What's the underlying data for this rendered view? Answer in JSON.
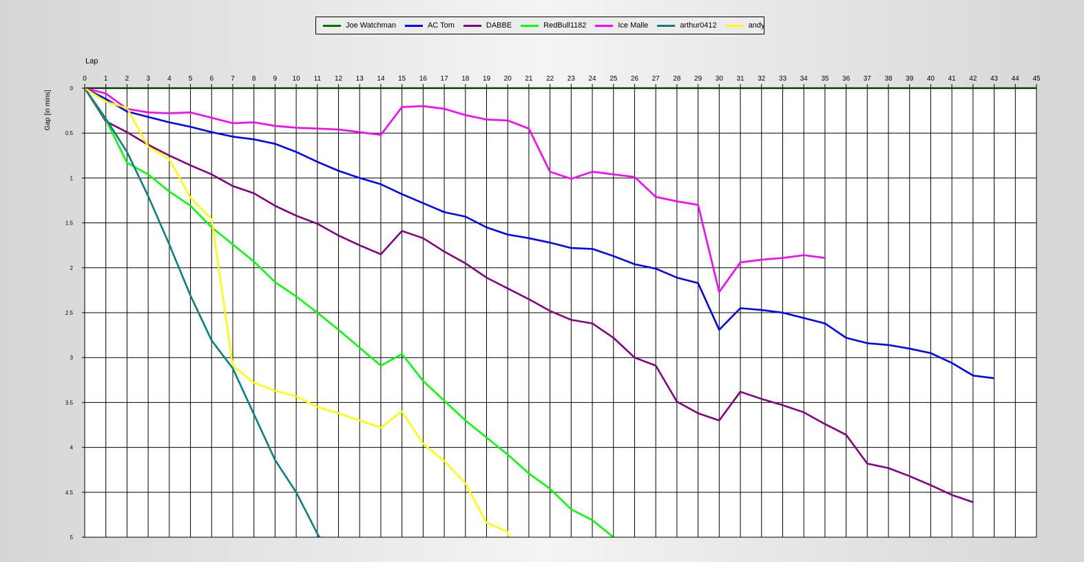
{
  "chart_data": {
    "type": "line",
    "xlabel": "Lap",
    "ylabel": "Gap [in mins]",
    "xlim": [
      0,
      45
    ],
    "ylim": [
      0,
      5
    ],
    "y_inverted": true,
    "grid": true,
    "legend_position": "top-center",
    "x_ticks": [
      0,
      1,
      2,
      3,
      4,
      5,
      6,
      7,
      8,
      9,
      10,
      11,
      12,
      13,
      14,
      15,
      16,
      17,
      18,
      19,
      20,
      21,
      22,
      23,
      24,
      25,
      26,
      27,
      28,
      29,
      30,
      31,
      32,
      33,
      34,
      35,
      36,
      37,
      38,
      39,
      40,
      41,
      42,
      43,
      44,
      45
    ],
    "y_ticks": [
      "0",
      "0.5",
      "1",
      "1.5",
      "2",
      "2.5",
      "3",
      "3.5",
      "4",
      "4.5",
      "5"
    ],
    "series": [
      {
        "name": "Joe Watchman",
        "color": "#007000",
        "points": [
          [
            0,
            0
          ],
          [
            1,
            0
          ],
          [
            2,
            0
          ],
          [
            3,
            0
          ],
          [
            4,
            0
          ],
          [
            5,
            0
          ],
          [
            6,
            0
          ],
          [
            7,
            0
          ],
          [
            8,
            0
          ],
          [
            9,
            0
          ],
          [
            10,
            0
          ],
          [
            11,
            0
          ],
          [
            12,
            0
          ],
          [
            13,
            0
          ],
          [
            14,
            0
          ],
          [
            15,
            0
          ],
          [
            16,
            0
          ],
          [
            17,
            0
          ],
          [
            18,
            0
          ],
          [
            19,
            0
          ],
          [
            20,
            0
          ],
          [
            21,
            0
          ],
          [
            22,
            0
          ],
          [
            23,
            0
          ],
          [
            24,
            0
          ],
          [
            25,
            0
          ],
          [
            26,
            0
          ],
          [
            27,
            0
          ],
          [
            28,
            0
          ],
          [
            29,
            0
          ],
          [
            30,
            0
          ],
          [
            31,
            0
          ],
          [
            32,
            0
          ],
          [
            33,
            0
          ],
          [
            34,
            0
          ],
          [
            35,
            0
          ],
          [
            36,
            0
          ],
          [
            37,
            0
          ],
          [
            38,
            0
          ],
          [
            39,
            0
          ],
          [
            40,
            0
          ],
          [
            41,
            0
          ],
          [
            42,
            0
          ],
          [
            43,
            0
          ],
          [
            44,
            0
          ],
          [
            45,
            0
          ]
        ]
      },
      {
        "name": "AC Tom",
        "color": "#0000ff",
        "points": [
          [
            0,
            0
          ],
          [
            1,
            0.12
          ],
          [
            2,
            0.26
          ],
          [
            3,
            0.32
          ],
          [
            4,
            0.38
          ],
          [
            5,
            0.43
          ],
          [
            6,
            0.49
          ],
          [
            7,
            0.54
          ],
          [
            8,
            0.57
          ],
          [
            9,
            0.62
          ],
          [
            10,
            0.71
          ],
          [
            11,
            0.82
          ],
          [
            12,
            0.92
          ],
          [
            13,
            1.0
          ],
          [
            14,
            1.07
          ],
          [
            15,
            1.18
          ],
          [
            16,
            1.28
          ],
          [
            17,
            1.38
          ],
          [
            18,
            1.43
          ],
          [
            19,
            1.55
          ],
          [
            20,
            1.63
          ],
          [
            21,
            1.67
          ],
          [
            22,
            1.72
          ],
          [
            23,
            1.78
          ],
          [
            24,
            1.79
          ],
          [
            25,
            1.87
          ],
          [
            26,
            1.96
          ],
          [
            27,
            2.01
          ],
          [
            28,
            2.11
          ],
          [
            29,
            2.17
          ],
          [
            30,
            2.69
          ],
          [
            31,
            2.45
          ],
          [
            32,
            2.47
          ],
          [
            33,
            2.5
          ],
          [
            34,
            2.56
          ],
          [
            35,
            2.62
          ],
          [
            36,
            2.78
          ],
          [
            37,
            2.84
          ],
          [
            38,
            2.86
          ],
          [
            39,
            2.9
          ],
          [
            40,
            2.95
          ],
          [
            41,
            3.06
          ],
          [
            42,
            3.2
          ],
          [
            43,
            3.23
          ]
        ]
      },
      {
        "name": "DABBE",
        "color": "#800080",
        "points": [
          [
            0,
            0
          ],
          [
            1,
            0.37
          ],
          [
            2,
            0.49
          ],
          [
            3,
            0.63
          ],
          [
            4,
            0.75
          ],
          [
            5,
            0.86
          ],
          [
            6,
            0.96
          ],
          [
            7,
            1.09
          ],
          [
            8,
            1.17
          ],
          [
            9,
            1.31
          ],
          [
            10,
            1.42
          ],
          [
            11,
            1.51
          ],
          [
            12,
            1.64
          ],
          [
            13,
            1.75
          ],
          [
            14,
            1.85
          ],
          [
            15,
            1.59
          ],
          [
            16,
            1.67
          ],
          [
            17,
            1.82
          ],
          [
            18,
            1.95
          ],
          [
            19,
            2.11
          ],
          [
            20,
            2.23
          ],
          [
            21,
            2.35
          ],
          [
            22,
            2.48
          ],
          [
            23,
            2.58
          ],
          [
            24,
            2.62
          ],
          [
            25,
            2.78
          ],
          [
            26,
            3.0
          ],
          [
            27,
            3.09
          ],
          [
            28,
            3.49
          ],
          [
            29,
            3.62
          ],
          [
            30,
            3.7
          ],
          [
            31,
            3.38
          ],
          [
            32,
            3.46
          ],
          [
            33,
            3.53
          ],
          [
            34,
            3.61
          ],
          [
            35,
            3.74
          ],
          [
            36,
            3.86
          ],
          [
            37,
            4.18
          ],
          [
            38,
            4.23
          ],
          [
            39,
            4.32
          ],
          [
            40,
            4.42
          ],
          [
            41,
            4.53
          ],
          [
            42,
            4.61
          ]
        ]
      },
      {
        "name": "RedBull1182",
        "color": "#00ff00",
        "points": [
          [
            0,
            0
          ],
          [
            1,
            0.35
          ],
          [
            2,
            0.83
          ],
          [
            3,
            0.96
          ],
          [
            4,
            1.15
          ],
          [
            5,
            1.31
          ],
          [
            6,
            1.55
          ],
          [
            7,
            1.74
          ],
          [
            8,
            1.93
          ],
          [
            9,
            2.16
          ],
          [
            10,
            2.32
          ],
          [
            11,
            2.5
          ],
          [
            12,
            2.69
          ],
          [
            13,
            2.89
          ],
          [
            14,
            3.09
          ],
          [
            15,
            2.96
          ],
          [
            16,
            3.26
          ],
          [
            17,
            3.48
          ],
          [
            18,
            3.7
          ],
          [
            19,
            3.89
          ],
          [
            20,
            4.08
          ],
          [
            21,
            4.29
          ],
          [
            22,
            4.46
          ],
          [
            23,
            4.69
          ],
          [
            24,
            4.81
          ],
          [
            25,
            5.0
          ]
        ]
      },
      {
        "name": "Ice Malle",
        "color": "#ff00ff",
        "points": [
          [
            0,
            0
          ],
          [
            1,
            0.06
          ],
          [
            2,
            0.23
          ],
          [
            3,
            0.27
          ],
          [
            4,
            0.28
          ],
          [
            5,
            0.27
          ],
          [
            6,
            0.33
          ],
          [
            7,
            0.39
          ],
          [
            8,
            0.38
          ],
          [
            9,
            0.42
          ],
          [
            10,
            0.44
          ],
          [
            11,
            0.45
          ],
          [
            12,
            0.46
          ],
          [
            13,
            0.49
          ],
          [
            14,
            0.52
          ],
          [
            15,
            0.21
          ],
          [
            16,
            0.2
          ],
          [
            17,
            0.23
          ],
          [
            18,
            0.3
          ],
          [
            19,
            0.35
          ],
          [
            20,
            0.36
          ],
          [
            21,
            0.45
          ],
          [
            22,
            0.93
          ],
          [
            23,
            1.01
          ],
          [
            24,
            0.93
          ],
          [
            25,
            0.96
          ],
          [
            26,
            0.99
          ],
          [
            27,
            1.21
          ],
          [
            28,
            1.26
          ],
          [
            29,
            1.3
          ],
          [
            30,
            2.27
          ],
          [
            31,
            1.94
          ],
          [
            32,
            1.91
          ],
          [
            33,
            1.89
          ],
          [
            34,
            1.86
          ],
          [
            35,
            1.89
          ]
        ]
      },
      {
        "name": "arthur0412",
        "color": "#008080",
        "points": [
          [
            0,
            0
          ],
          [
            1,
            0.34
          ],
          [
            2,
            0.71
          ],
          [
            3,
            1.2
          ],
          [
            4,
            1.74
          ],
          [
            5,
            2.31
          ],
          [
            6,
            2.81
          ],
          [
            7,
            3.12
          ],
          [
            8,
            3.63
          ],
          [
            9,
            4.14
          ],
          [
            10,
            4.5
          ],
          [
            11,
            4.96
          ],
          [
            11.1,
            5.0
          ]
        ]
      },
      {
        "name": "andymaz",
        "color": "#ffff00",
        "points": [
          [
            0,
            0
          ],
          [
            1,
            0.15
          ],
          [
            2,
            0.22
          ],
          [
            3,
            0.65
          ],
          [
            4,
            0.79
          ],
          [
            5,
            1.22
          ],
          [
            6,
            1.46
          ],
          [
            7,
            3.09
          ],
          [
            8,
            3.28
          ],
          [
            9,
            3.37
          ],
          [
            10,
            3.43
          ],
          [
            11,
            3.55
          ],
          [
            12,
            3.62
          ],
          [
            13,
            3.7
          ],
          [
            14,
            3.78
          ],
          [
            15,
            3.6
          ],
          [
            16,
            3.96
          ],
          [
            17,
            4.15
          ],
          [
            18,
            4.4
          ],
          [
            19,
            4.84
          ],
          [
            20,
            4.94
          ],
          [
            20.05,
            5.0
          ]
        ]
      }
    ]
  }
}
